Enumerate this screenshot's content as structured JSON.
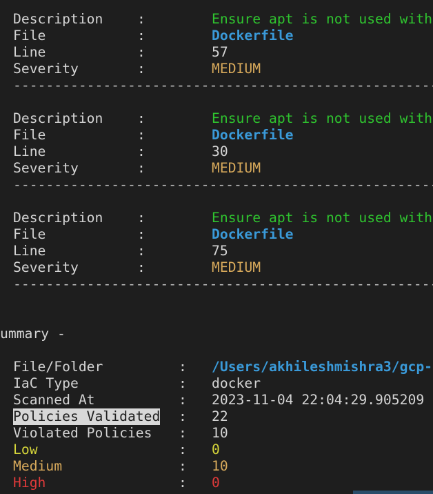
{
  "findings": [
    {
      "description_label": "Description",
      "description_value": "Ensure apt is not used with",
      "file_label": "File",
      "file_value": "Dockerfile",
      "line_label": "Line",
      "line_value": "57",
      "severity_label": "Severity",
      "severity_value": "MEDIUM"
    },
    {
      "description_label": "Description",
      "description_value": "Ensure apt is not used with",
      "file_label": "File",
      "file_value": "Dockerfile",
      "line_label": "Line",
      "line_value": "30",
      "severity_label": "Severity",
      "severity_value": "MEDIUM"
    },
    {
      "description_label": "Description",
      "description_value": "Ensure apt is not used with",
      "file_label": "File",
      "file_value": "Dockerfile",
      "line_label": "Line",
      "line_value": "75",
      "severity_label": "Severity",
      "severity_value": "MEDIUM"
    }
  ],
  "separator": ":",
  "divider": "------------------------------------------------------------",
  "summary": {
    "heading": "ummary -",
    "rows": [
      {
        "label": "File/Folder",
        "value": "/Users/akhileshmishra3/gcp-"
      },
      {
        "label": "IaC Type",
        "value": "docker"
      },
      {
        "label": "Scanned At",
        "value": "2023-11-04 22:04:29.905209"
      },
      {
        "label": "Policies Validated",
        "value": "22"
      },
      {
        "label": "Violated Policies",
        "value": "10"
      },
      {
        "label": "Low",
        "value": "0"
      },
      {
        "label": "Medium",
        "value": "10"
      },
      {
        "label": "High",
        "value": "0"
      }
    ]
  },
  "colors": {
    "background": "#1e1e1e",
    "description_value": "#2fc42f",
    "file_value": "#3a9ad9",
    "severity_medium": "#d7a95b",
    "low": "#d6d63a",
    "medium": "#d7a95b",
    "high": "#e03a3a"
  }
}
